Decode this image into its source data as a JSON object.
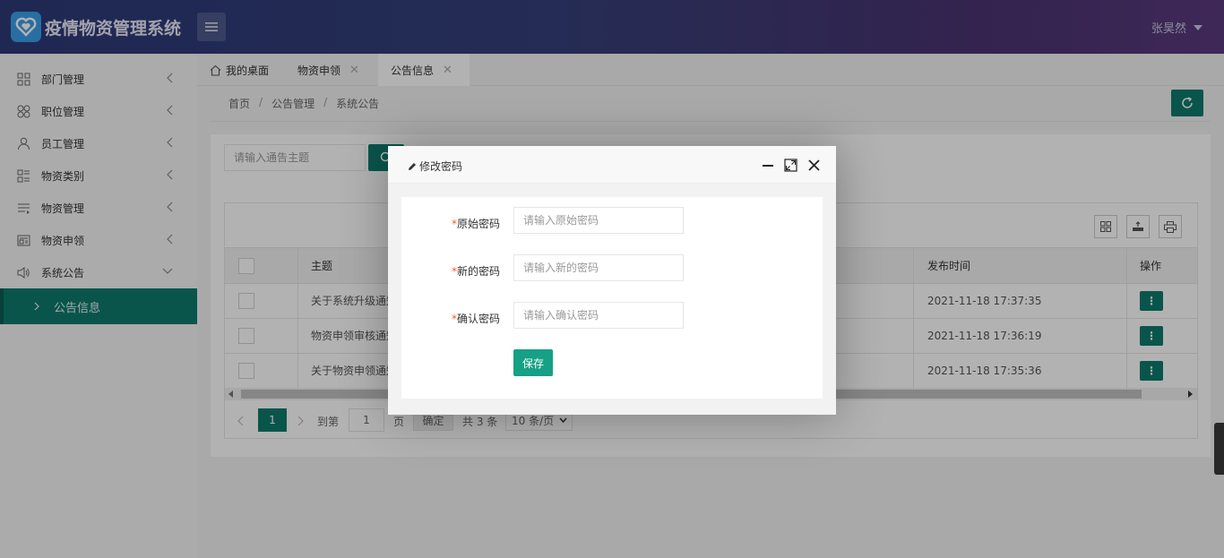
{
  "app": {
    "title": "疫情物资管理系统",
    "user": "张昊然"
  },
  "sidebar": {
    "items": [
      {
        "label": "部门管理",
        "icon": "grid-icon"
      },
      {
        "label": "职位管理",
        "icon": "clover-icon"
      },
      {
        "label": "员工管理",
        "icon": "user-icon"
      },
      {
        "label": "物资类别",
        "icon": "category-icon"
      },
      {
        "label": "物资管理",
        "icon": "list-icon"
      },
      {
        "label": "物资申领",
        "icon": "form-icon"
      },
      {
        "label": "系统公告",
        "icon": "speaker-icon"
      }
    ],
    "sub_item": "公告信息"
  },
  "tabs": [
    {
      "label": "我的桌面"
    },
    {
      "label": "物资申领"
    },
    {
      "label": "公告信息"
    }
  ],
  "breadcrumb": [
    "首页",
    "公告管理",
    "系统公告"
  ],
  "search": {
    "placeholder": "请输入通告主题"
  },
  "table": {
    "headers": {
      "title": "主题",
      "time": "发布时间",
      "ops": "操作"
    },
    "rows": [
      {
        "title": "关于系统升级通知",
        "time": "2021-11-18 17:37:35"
      },
      {
        "title": "物资申领审核通知",
        "time": "2021-11-18 17:36:19"
      },
      {
        "title": "关于物资申领通知",
        "time": "2021-11-18 17:35:36"
      }
    ],
    "op_label": "⋮"
  },
  "pager": {
    "current": "1",
    "goto_label": "到第",
    "page_value": "1",
    "page_unit": "页",
    "confirm": "确定",
    "total": "共 3 条",
    "per_page": "10 条/页"
  },
  "modal": {
    "title": "修改密码",
    "fields": [
      {
        "label": "原始密码",
        "placeholder": "请输入原始密码"
      },
      {
        "label": "新的密码",
        "placeholder": "请输入新的密码"
      },
      {
        "label": "确认密码",
        "placeholder": "请输入确认密码"
      }
    ],
    "required_mark": "*",
    "save": "保存"
  },
  "colors": {
    "primary": "#0e7a6d",
    "save": "#16a085",
    "header_start": "#2c3a78",
    "header_end": "#5a3a7e"
  }
}
